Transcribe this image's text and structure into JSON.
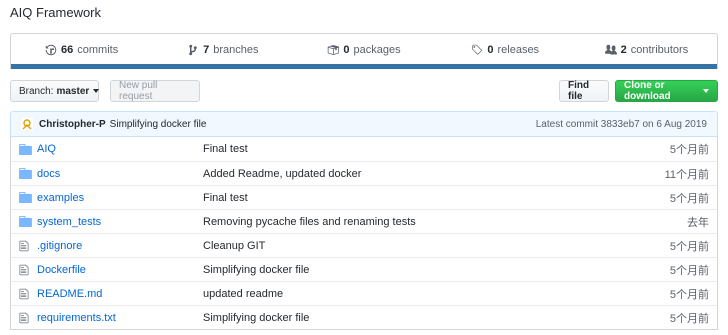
{
  "repo": {
    "title": "AIQ Framework"
  },
  "summary": {
    "commits": {
      "count": "66",
      "label": "commits",
      "icon": "history-icon"
    },
    "branches": {
      "count": "7",
      "label": "branches",
      "icon": "branch-icon"
    },
    "packages": {
      "count": "0",
      "label": "packages",
      "icon": "package-icon"
    },
    "releases": {
      "count": "0",
      "label": "releases",
      "icon": "tag-icon"
    },
    "contributors": {
      "count": "2",
      "label": "contributors",
      "icon": "people-icon"
    },
    "language_color": "#3572A5"
  },
  "toolbar": {
    "branch_label": "Branch:",
    "branch_name": "master",
    "new_pr": "New pull request",
    "find_file": "Find file",
    "clone": "Clone or download"
  },
  "commit": {
    "author": "Christopher-P",
    "message": "Simplifying docker file",
    "latest_label": "Latest commit",
    "sha": "3833eb7",
    "date": "on 6 Aug 2019"
  },
  "files": [
    {
      "type": "dir",
      "name": "AIQ",
      "message": "Final test",
      "age": "5个月前"
    },
    {
      "type": "dir",
      "name": "docs",
      "message": "Added Readme, updated docker",
      "age": "11个月前"
    },
    {
      "type": "dir",
      "name": "examples",
      "message": "Final test",
      "age": "5个月前"
    },
    {
      "type": "dir",
      "name": "system_tests",
      "message": "Removing pycache files and renaming tests",
      "age": "去年"
    },
    {
      "type": "file",
      "name": ".gitignore",
      "message": "Cleanup GIT",
      "age": "5个月前"
    },
    {
      "type": "file",
      "name": "Dockerfile",
      "message": "Simplifying docker file",
      "age": "5个月前"
    },
    {
      "type": "file",
      "name": "README.md",
      "message": "updated readme",
      "age": "5个月前"
    },
    {
      "type": "file",
      "name": "requirements.txt",
      "message": "Simplifying docker file",
      "age": "5个月前"
    }
  ]
}
